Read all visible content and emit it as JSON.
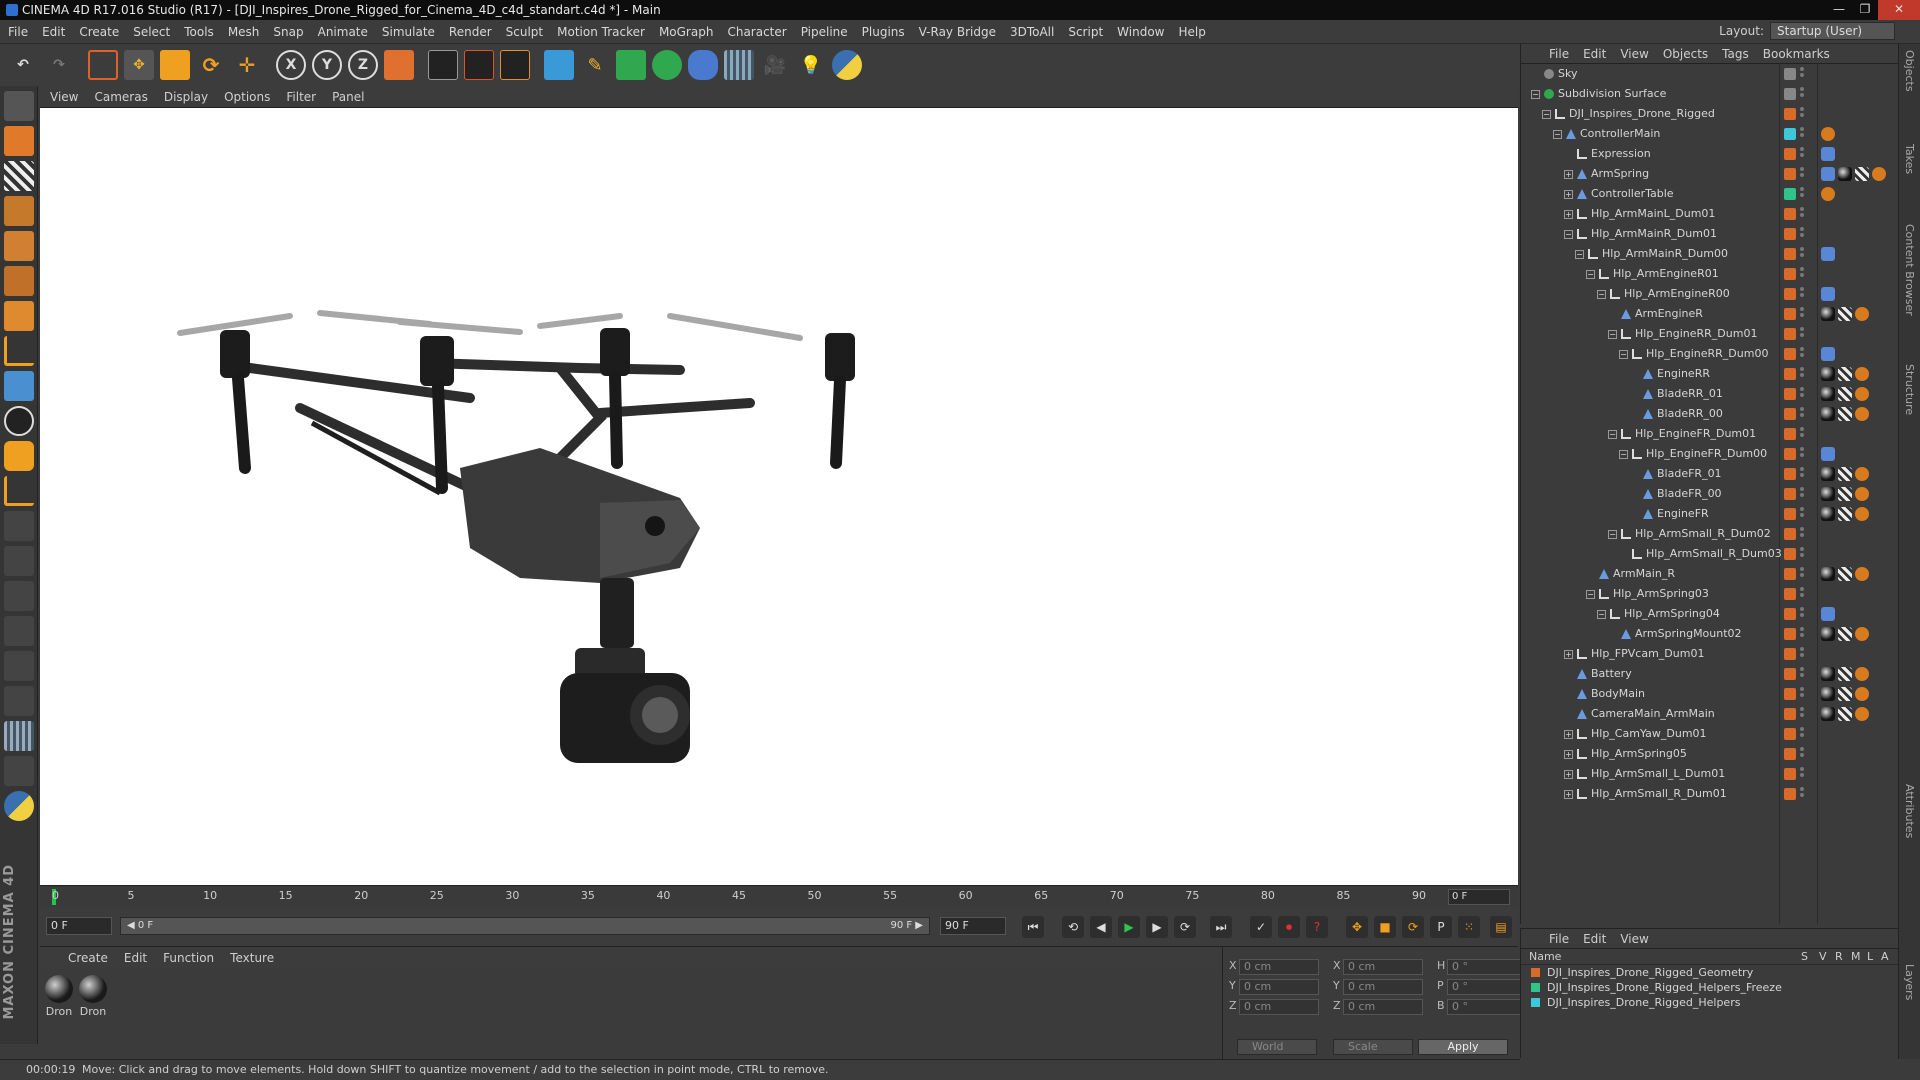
{
  "title": "CINEMA 4D R17.016 Studio (R17) - [DJI_Inspires_Drone_Rigged_for_Cinema_4D_c4d_standart.c4d *] - Main",
  "menu": [
    "File",
    "Edit",
    "Create",
    "Select",
    "Tools",
    "Mesh",
    "Snap",
    "Animate",
    "Simulate",
    "Render",
    "Sculpt",
    "Motion Tracker",
    "MoGraph",
    "Character",
    "Pipeline",
    "Plugins",
    "V-Ray Bridge",
    "3DToAll",
    "Script",
    "Window",
    "Help"
  ],
  "layout_label": "Layout:",
  "layout_value": "Startup (User)",
  "toolbar": {
    "x": "X",
    "y": "Y",
    "z": "Z"
  },
  "viewport_menu": [
    "View",
    "Cameras",
    "Display",
    "Options",
    "Filter",
    "Panel"
  ],
  "timeline": {
    "ticks": [
      "0",
      "5",
      "10",
      "15",
      "20",
      "25",
      "30",
      "35",
      "40",
      "45",
      "50",
      "55",
      "60",
      "65",
      "70",
      "75",
      "80",
      "85",
      "90"
    ],
    "frame_right": "0 F"
  },
  "transport": {
    "start": "0 F",
    "slider_left": "◀ 0 F",
    "slider_right": "90 F ▶",
    "end": "90 F"
  },
  "material_menu": [
    "Create",
    "Edit",
    "Function",
    "Texture"
  ],
  "materials": [
    "Dron",
    "Dron"
  ],
  "coords": {
    "rows": [
      {
        "a1": "X",
        "v1": "0 cm",
        "a2": "X",
        "v2": "0 cm",
        "a3": "H",
        "v3": "0 °"
      },
      {
        "a1": "Y",
        "v1": "0 cm",
        "a2": "Y",
        "v2": "0 cm",
        "a3": "P",
        "v3": "0 °"
      },
      {
        "a1": "Z",
        "v1": "0 cm",
        "a2": "Z",
        "v2": "0 cm",
        "a3": "B",
        "v3": "0 °"
      }
    ],
    "space": "World",
    "mode": "Scale",
    "apply": "Apply"
  },
  "status": {
    "time": "00:00:19",
    "message": "Move: Click and drag to move elements. Hold down SHIFT to quantize movement / add to the selection in point mode, CTRL to remove."
  },
  "brand": "MAXON CINEMA 4D",
  "objmenu": [
    "File",
    "Edit",
    "View",
    "Objects",
    "Tags",
    "Bookmarks"
  ],
  "objects": [
    {
      "name": "Sky",
      "depth": 0,
      "exp": "",
      "icon": "sky",
      "tag": "#888888",
      "tags": []
    },
    {
      "name": "Subdivision Surface",
      "depth": 0,
      "exp": "−",
      "icon": "green",
      "tag": "#888888",
      "tags": []
    },
    {
      "name": "DJI_Inspires_Drone_Rigged",
      "depth": 1,
      "exp": "−",
      "icon": "null",
      "tag": "#d86a2a",
      "tags": []
    },
    {
      "name": "ControllerMain",
      "depth": 2,
      "exp": "−",
      "icon": "joint",
      "tag": "#3ec7d8",
      "tags": [
        "xp"
      ]
    },
    {
      "name": "Expression",
      "depth": 3,
      "exp": "",
      "icon": "null",
      "tag": "#d86a2a",
      "tags": [
        "bl"
      ]
    },
    {
      "name": "ArmSpring",
      "depth": 3,
      "exp": "+",
      "icon": "joint",
      "tag": "#d86a2a",
      "tags": [
        "bl",
        "mat",
        "chk",
        "xp"
      ]
    },
    {
      "name": "ControllerTable",
      "depth": 3,
      "exp": "+",
      "icon": "joint",
      "tag": "#2fc48a",
      "tags": [
        "xp"
      ]
    },
    {
      "name": "Hlp_ArmMainL_Dum01",
      "depth": 3,
      "exp": "+",
      "icon": "null",
      "tag": "#d86a2a",
      "tags": []
    },
    {
      "name": "Hlp_ArmMainR_Dum01",
      "depth": 3,
      "exp": "−",
      "icon": "null",
      "tag": "#d86a2a",
      "tags": []
    },
    {
      "name": "Hlp_ArmMainR_Dum00",
      "depth": 4,
      "exp": "−",
      "icon": "null",
      "tag": "#d86a2a",
      "tags": [
        "bl"
      ]
    },
    {
      "name": "Hlp_ArmEngineR01",
      "depth": 5,
      "exp": "−",
      "icon": "null",
      "tag": "#d86a2a",
      "tags": []
    },
    {
      "name": "Hlp_ArmEngineR00",
      "depth": 6,
      "exp": "−",
      "icon": "null",
      "tag": "#d86a2a",
      "tags": [
        "bl"
      ]
    },
    {
      "name": "ArmEngineR",
      "depth": 7,
      "exp": "",
      "icon": "joint",
      "tag": "#d86a2a",
      "tags": [
        "mat",
        "chk",
        "xp"
      ]
    },
    {
      "name": "Hlp_EngineRR_Dum01",
      "depth": 7,
      "exp": "−",
      "icon": "null",
      "tag": "#d86a2a",
      "tags": []
    },
    {
      "name": "Hlp_EngineRR_Dum00",
      "depth": 8,
      "exp": "−",
      "icon": "null",
      "tag": "#d86a2a",
      "tags": [
        "bl"
      ]
    },
    {
      "name": "EngineRR",
      "depth": 9,
      "exp": "",
      "icon": "joint",
      "tag": "#d86a2a",
      "tags": [
        "mat",
        "chk",
        "xp"
      ]
    },
    {
      "name": "BladeRR_01",
      "depth": 9,
      "exp": "",
      "icon": "joint",
      "tag": "#d86a2a",
      "tags": [
        "mat",
        "chk",
        "xp"
      ]
    },
    {
      "name": "BladeRR_00",
      "depth": 9,
      "exp": "",
      "icon": "joint",
      "tag": "#d86a2a",
      "tags": [
        "mat",
        "chk",
        "xp"
      ]
    },
    {
      "name": "Hlp_EngineFR_Dum01",
      "depth": 7,
      "exp": "−",
      "icon": "null",
      "tag": "#d86a2a",
      "tags": []
    },
    {
      "name": "Hlp_EngineFR_Dum00",
      "depth": 8,
      "exp": "−",
      "icon": "null",
      "tag": "#d86a2a",
      "tags": [
        "bl"
      ]
    },
    {
      "name": "BladeFR_01",
      "depth": 9,
      "exp": "",
      "icon": "joint",
      "tag": "#d86a2a",
      "tags": [
        "mat",
        "chk",
        "xp"
      ]
    },
    {
      "name": "BladeFR_00",
      "depth": 9,
      "exp": "",
      "icon": "joint",
      "tag": "#d86a2a",
      "tags": [
        "mat",
        "chk",
        "xp"
      ]
    },
    {
      "name": "EngineFR",
      "depth": 9,
      "exp": "",
      "icon": "joint",
      "tag": "#d86a2a",
      "tags": [
        "mat",
        "chk",
        "xp"
      ]
    },
    {
      "name": "Hlp_ArmSmall_R_Dum02",
      "depth": 7,
      "exp": "−",
      "icon": "null",
      "tag": "#d86a2a",
      "tags": []
    },
    {
      "name": "Hlp_ArmSmall_R_Dum03",
      "depth": 8,
      "exp": "",
      "icon": "null",
      "tag": "#d86a2a",
      "tags": []
    },
    {
      "name": "ArmMain_R",
      "depth": 5,
      "exp": "",
      "icon": "joint",
      "tag": "#d86a2a",
      "tags": [
        "mat",
        "chk",
        "xp"
      ]
    },
    {
      "name": "Hlp_ArmSpring03",
      "depth": 5,
      "exp": "−",
      "icon": "null",
      "tag": "#d86a2a",
      "tags": []
    },
    {
      "name": "Hlp_ArmSpring04",
      "depth": 6,
      "exp": "−",
      "icon": "null",
      "tag": "#d86a2a",
      "tags": [
        "bl"
      ]
    },
    {
      "name": "ArmSpringMount02",
      "depth": 7,
      "exp": "",
      "icon": "joint",
      "tag": "#d86a2a",
      "tags": [
        "mat",
        "chk",
        "xp"
      ]
    },
    {
      "name": "Hlp_FPVcam_Dum01",
      "depth": 3,
      "exp": "+",
      "icon": "null",
      "tag": "#d86a2a",
      "tags": []
    },
    {
      "name": "Battery",
      "depth": 3,
      "exp": "",
      "icon": "joint",
      "tag": "#d86a2a",
      "tags": [
        "mat",
        "chk",
        "xp"
      ]
    },
    {
      "name": "BodyMain",
      "depth": 3,
      "exp": "",
      "icon": "joint",
      "tag": "#d86a2a",
      "tags": [
        "mat",
        "chk",
        "xp"
      ]
    },
    {
      "name": "CameraMain_ArmMain",
      "depth": 3,
      "exp": "",
      "icon": "joint",
      "tag": "#d86a2a",
      "tags": [
        "mat",
        "chk",
        "xp"
      ]
    },
    {
      "name": "Hlp_CamYaw_Dum01",
      "depth": 3,
      "exp": "+",
      "icon": "null",
      "tag": "#d86a2a",
      "tags": []
    },
    {
      "name": "Hlp_ArmSpring05",
      "depth": 3,
      "exp": "+",
      "icon": "null",
      "tag": "#d86a2a",
      "tags": []
    },
    {
      "name": "Hlp_ArmSmall_L_Dum01",
      "depth": 3,
      "exp": "+",
      "icon": "null",
      "tag": "#d86a2a",
      "tags": []
    },
    {
      "name": "Hlp_ArmSmall_R_Dum01",
      "depth": 3,
      "exp": "+",
      "icon": "null",
      "tag": "#d86a2a",
      "tags": []
    }
  ],
  "layermenu": [
    "File",
    "Edit",
    "View"
  ],
  "layer_cols": {
    "name": "Name",
    "s": "S",
    "v": "V",
    "r": "R",
    "m": "M",
    "l": "L",
    "a": "A"
  },
  "layers": [
    {
      "name": "DJI_Inspires_Drone_Rigged_Geometry",
      "color": "#d86a2a"
    },
    {
      "name": "DJI_Inspires_Drone_Rigged_Helpers_Freeze",
      "color": "#2fc48a"
    },
    {
      "name": "DJI_Inspires_Drone_Rigged_Helpers",
      "color": "#3ec7d8"
    }
  ],
  "right_tabs": [
    "Objects",
    "Takes",
    "Content Browser",
    "Structure",
    "Attributes",
    "Layers"
  ],
  "colors": {
    "accent_green": "#27c24c",
    "tag_orange": "#d86a2a"
  }
}
